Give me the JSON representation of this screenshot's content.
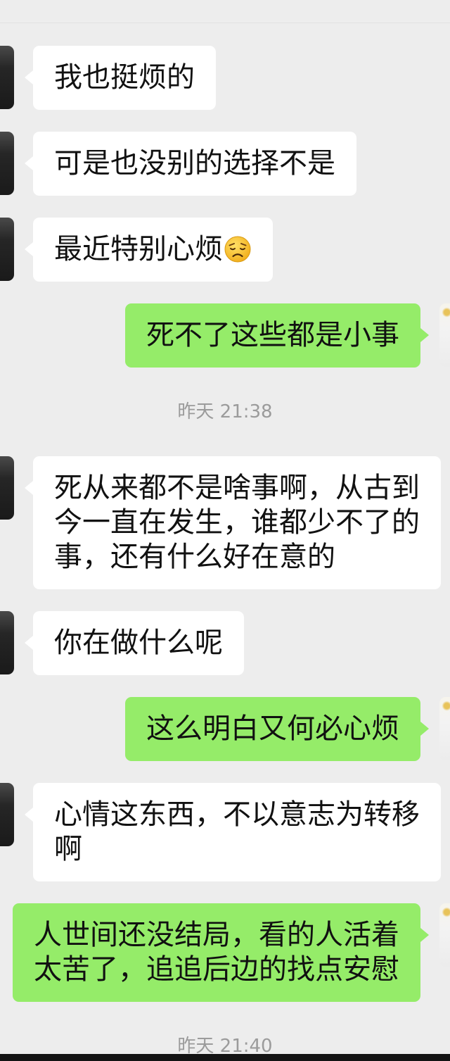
{
  "colors": {
    "background": "#ededed",
    "received_bubble": "#ffffff",
    "sent_bubble": "#95ec69",
    "text": "#111111",
    "timestamp": "#9b9b9b"
  },
  "chat": {
    "messages": [
      {
        "type": "received",
        "text": "我也挺烦的"
      },
      {
        "type": "received",
        "text": "可是也没别的选择不是"
      },
      {
        "type": "received",
        "text": "最近特别心烦",
        "emoji": "sad-face-icon"
      },
      {
        "type": "sent",
        "text": "死不了这些都是小事"
      },
      {
        "type": "timestamp",
        "text": "昨天 21:38"
      },
      {
        "type": "received",
        "text": "死从来都不是啥事啊，从古到今一直在发生，谁都少不了的事，还有什么好在意的"
      },
      {
        "type": "received",
        "text": "你在做什么呢"
      },
      {
        "type": "sent",
        "text": "这么明白又何必心烦"
      },
      {
        "type": "received",
        "text": "心情这东西，不以意志为转移啊"
      },
      {
        "type": "sent",
        "text": "人世间还没结局，看的人活着太苦了，追追后边的找点安慰"
      },
      {
        "type": "timestamp",
        "text": "昨天 21:40"
      }
    ]
  }
}
